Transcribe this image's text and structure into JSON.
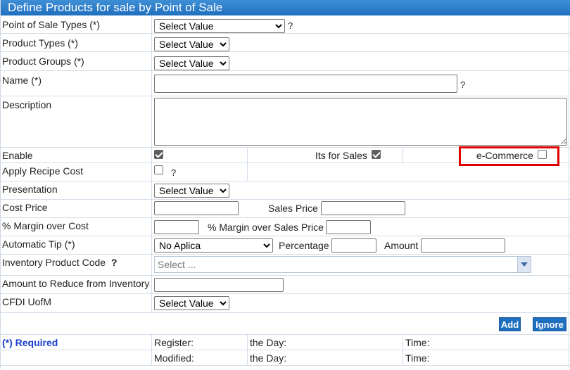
{
  "title": "Define Products for sale by Point of Sale",
  "help_mark": "?",
  "fields": {
    "pos_types": {
      "label": "Point of Sale Types (*)",
      "value": "Select Value"
    },
    "product_types": {
      "label": "Product Types (*)",
      "value": "Select Value"
    },
    "product_groups": {
      "label": "Product Groups (*)",
      "value": "Select Value"
    },
    "name": {
      "label": "Name (*)",
      "value": ""
    },
    "description": {
      "label": "Description",
      "value": ""
    },
    "enable": {
      "label": "Enable",
      "checked": true
    },
    "its_for_sales": {
      "label": "Its for Sales",
      "checked": true
    },
    "ecommerce": {
      "label": "e-Commerce",
      "checked": false
    },
    "apply_recipe_cost": {
      "label": "Apply Recipe Cost",
      "checked": false
    },
    "presentation": {
      "label": "Presentation",
      "value": "Select Value"
    },
    "cost_price": {
      "label": "Cost Price",
      "value": ""
    },
    "sales_price": {
      "label": "Sales Price",
      "value": ""
    },
    "margin_cost": {
      "label": "% Margin over Cost",
      "value": ""
    },
    "margin_sales": {
      "label": "% Margin over Sales Price",
      "value": ""
    },
    "automatic_tip": {
      "label": "Automatic Tip (*)",
      "value": "No Aplica"
    },
    "percentage": {
      "label": "Percentage",
      "value": ""
    },
    "amount": {
      "label": "Amount",
      "value": ""
    },
    "inventory_code": {
      "label": "Inventory Product Code",
      "placeholder": "Select ..."
    },
    "reduce_inventory": {
      "label": "Amount to Reduce from Inventory",
      "value": ""
    },
    "cfdi_uofm": {
      "label": "CFDI UofM",
      "value": "Select Value"
    }
  },
  "buttons": {
    "add": "Add",
    "ignore": "Ignore"
  },
  "footer": {
    "required": "(*) Required",
    "register": "Register:",
    "modified": "Modified:",
    "the_day": "the Day:",
    "time": "Time:"
  },
  "colors": {
    "title_bar": "#1f6fbf",
    "highlight": "#e00000",
    "required_text": "#1a3fcf"
  }
}
